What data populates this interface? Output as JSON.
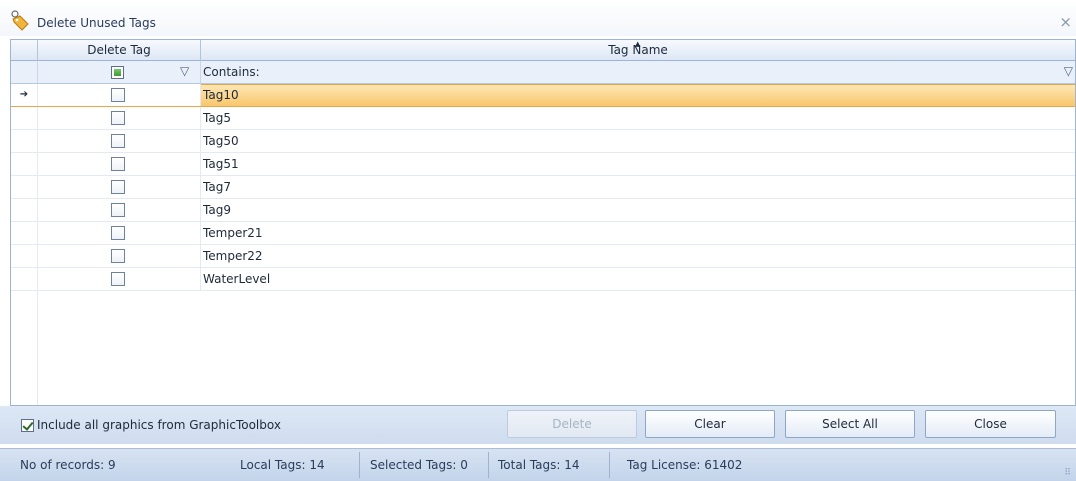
{
  "window": {
    "title": "Delete Unused Tags",
    "close_glyph": "×",
    "icon": "tag-icon"
  },
  "grid": {
    "columns": [
      "Delete Tag",
      "Tag Name"
    ],
    "filter_text": "Contains:",
    "rows": [
      {
        "name": "Tag10",
        "checked": false,
        "current": true
      },
      {
        "name": "Tag5",
        "checked": false
      },
      {
        "name": "Tag50",
        "checked": false
      },
      {
        "name": "Tag51",
        "checked": false
      },
      {
        "name": "Tag7",
        "checked": false
      },
      {
        "name": "Tag9",
        "checked": false
      },
      {
        "name": "Temper21",
        "checked": false
      },
      {
        "name": "Temper22",
        "checked": false
      },
      {
        "name": "WaterLevel",
        "checked": false
      }
    ]
  },
  "options": {
    "include_graphics_label": "Include all graphics from GraphicToolbox",
    "include_graphics_checked": true
  },
  "buttons": {
    "delete": "Delete",
    "clear": "Clear",
    "select_all": "Select All",
    "close": "Close"
  },
  "status": {
    "records": "No of records: 9",
    "local_tags": "Local Tags: 14",
    "selected_tags": "Selected Tags: 0",
    "total_tags": "Total Tags: 14",
    "tag_license": "Tag License: 61402"
  },
  "colors": {
    "selected_row": "#f9c66b",
    "accent": "#9db4d2"
  }
}
